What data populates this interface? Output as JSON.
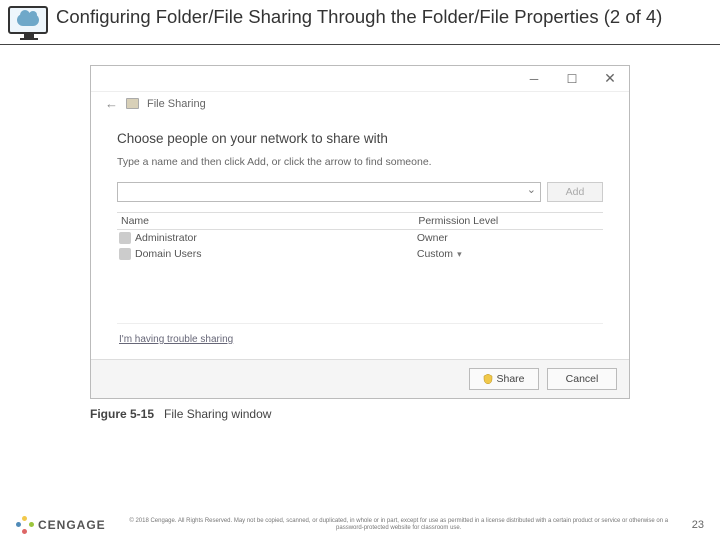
{
  "slide": {
    "title": "Configuring Folder/File Sharing Through the Folder/File Properties (2 of 4)",
    "page_number": "23"
  },
  "window": {
    "title": "File Sharing",
    "heading": "Choose people on your network to share with",
    "instruction": "Type a name and then click Add, or click the arrow to find someone.",
    "add_button": "Add",
    "columns": {
      "name": "Name",
      "permission": "Permission Level"
    },
    "rows": [
      {
        "name": "Administrator",
        "permission": "Owner",
        "has_menu": false
      },
      {
        "name": "Domain Users",
        "permission": "Custom",
        "has_menu": true
      }
    ],
    "trouble_link": "I'm having trouble sharing",
    "share_button": "Share",
    "cancel_button": "Cancel"
  },
  "figure": {
    "label": "Figure 5-15",
    "caption": "File Sharing window"
  },
  "brand": "CENGAGE",
  "copyright": "© 2018 Cengage. All Rights Reserved. May not be copied, scanned, or duplicated, in whole or in part, except for use as permitted in a license distributed with a certain product or service or otherwise on a password-protected website for classroom use."
}
